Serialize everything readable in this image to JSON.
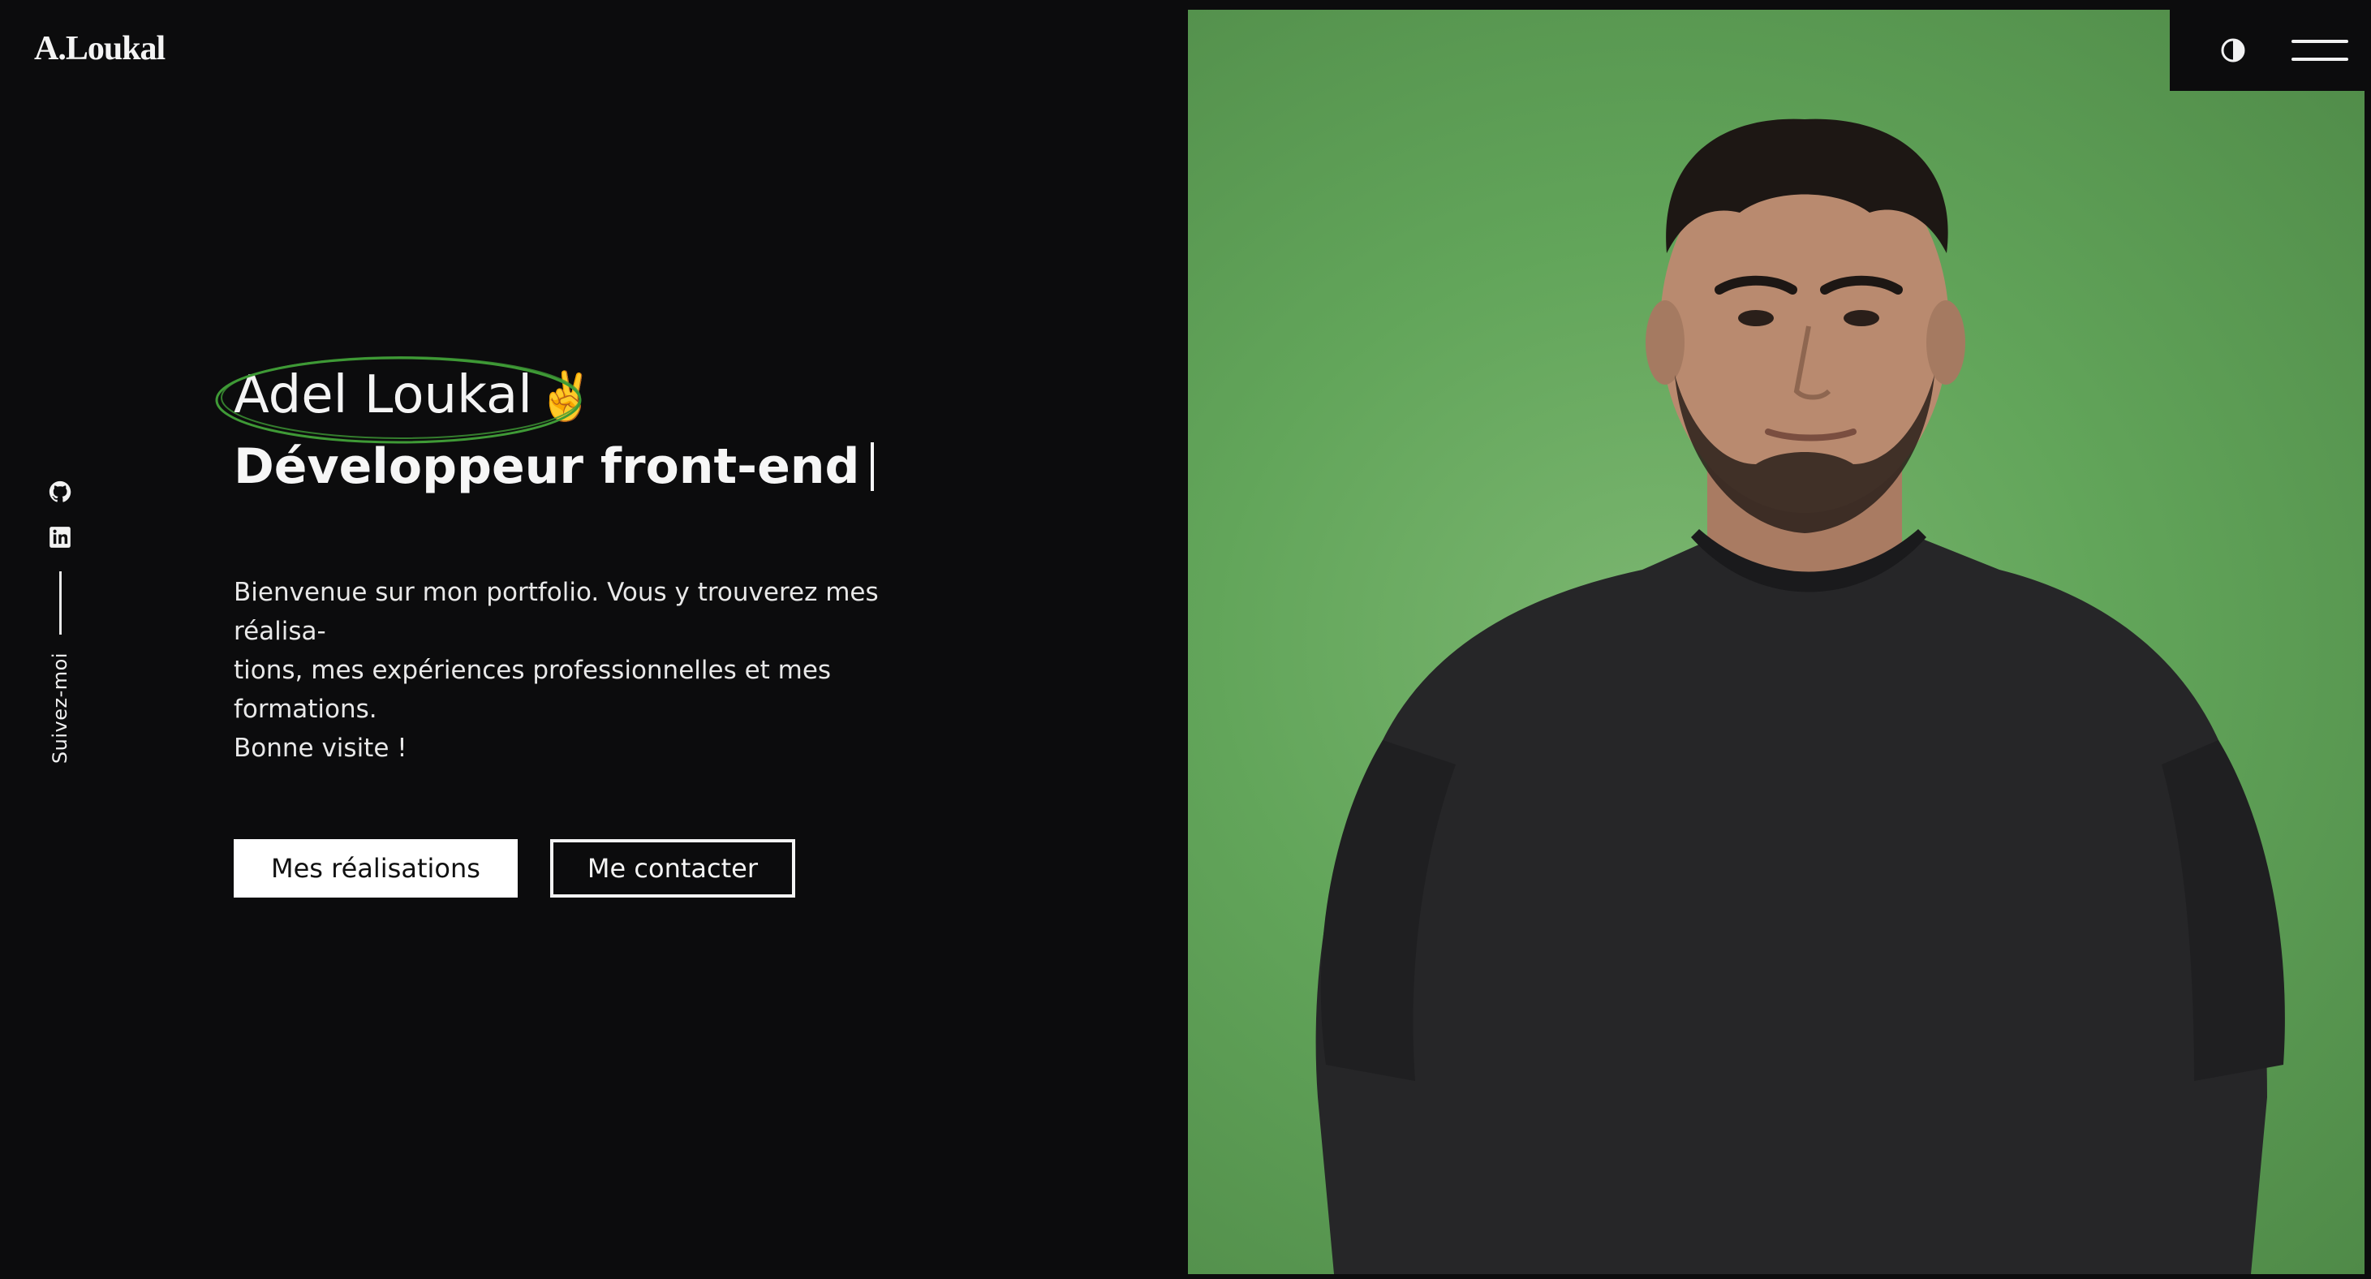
{
  "header": {
    "logo_text": "A.Loukal",
    "theme_toggle_icon": "contrast-icon",
    "menu_icon": "hamburger-menu-icon"
  },
  "social": {
    "github_icon": "github-icon",
    "linkedin_icon": "linkedin-icon",
    "follow_label": "Suivez-moi"
  },
  "hero": {
    "name": "Adel Loukal",
    "name_emoji": "✌️",
    "title": "Développeur front-end",
    "intro_line1": "Bienvenue sur mon portfolio. Vous y trouverez mes réalisa-",
    "intro_line2": "tions, mes expériences professionnelles et mes formations.",
    "intro_line3": "Bonne visite !",
    "primary_button": "Mes réalisations",
    "secondary_button": "Me contacter"
  },
  "colors": {
    "background": "#0c0c0d",
    "photo_backdrop": "#62a55a",
    "name_highlight": "#3f9a36",
    "text": "#f4f4f4"
  }
}
